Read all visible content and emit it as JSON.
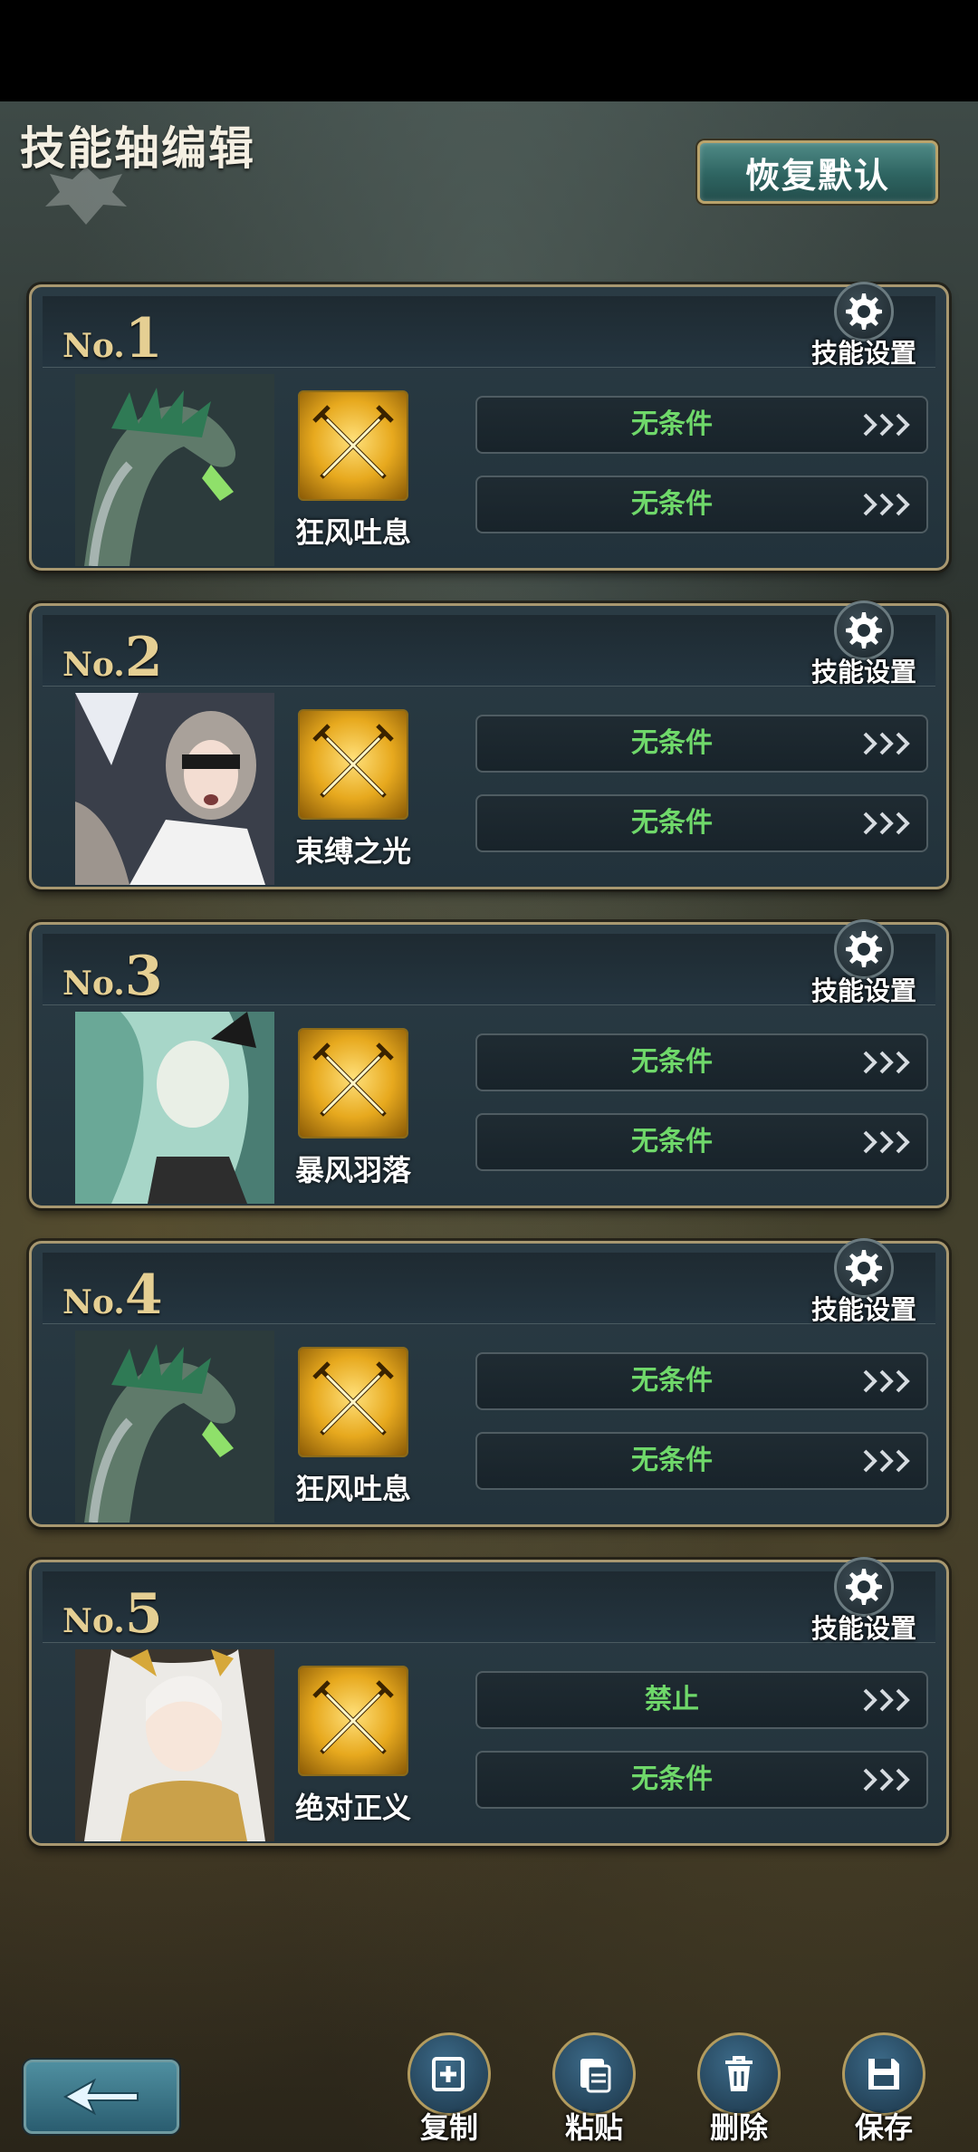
{
  "header": {
    "title": "技能轴编辑",
    "reset_label": "恢复默认"
  },
  "cards": [
    {
      "no_prefix": "No.",
      "no_number": "1",
      "settings_label": "技能设置",
      "portrait": "green-dragon",
      "skill_name": "狂风吐息",
      "conditions": [
        "无条件",
        "无条件"
      ]
    },
    {
      "no_prefix": "No.",
      "no_number": "2",
      "settings_label": "技能设置",
      "portrait": "blindfolded-girl",
      "skill_name": "束缚之光",
      "conditions": [
        "无条件",
        "无条件"
      ]
    },
    {
      "no_prefix": "No.",
      "no_number": "3",
      "settings_label": "技能设置",
      "portrait": "teal-haired-woman",
      "skill_name": "暴风羽落",
      "conditions": [
        "无条件",
        "无条件"
      ]
    },
    {
      "no_prefix": "No.",
      "no_number": "4",
      "settings_label": "技能设置",
      "portrait": "green-dragon",
      "skill_name": "狂风吐息",
      "conditions": [
        "无条件",
        "无条件"
      ]
    },
    {
      "no_prefix": "No.",
      "no_number": "5",
      "settings_label": "技能设置",
      "portrait": "white-haired-girl",
      "skill_name": "绝对正义",
      "conditions": [
        "禁止",
        "无条件"
      ]
    }
  ],
  "toolbar": {
    "copy_label": "复制",
    "paste_label": "粘贴",
    "delete_label": "删除",
    "save_label": "保存"
  },
  "icons": {
    "settings": "gear-icon",
    "skill": "crossed-swords-icon",
    "condition_arrow": "triple-chevron-right-icon",
    "back": "back-arrow-icon",
    "copy": "copy-plus-icon",
    "paste": "paste-icon",
    "delete": "trash-icon",
    "save": "save-disk-icon"
  },
  "colors": {
    "condition_text": "#6fd86a",
    "accent_gold": "#e5cf93",
    "reset_button": "#2e6461"
  }
}
